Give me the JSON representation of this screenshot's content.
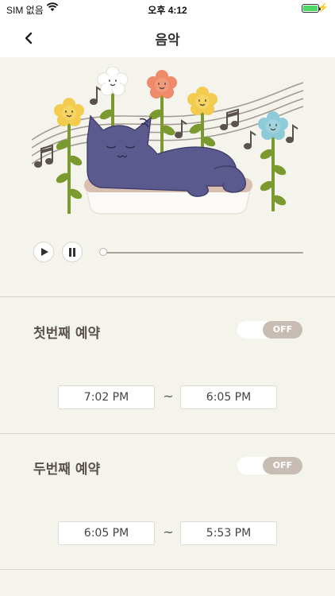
{
  "status_bar": {
    "carrier": "SIM 없음",
    "time": "오후 4:12"
  },
  "nav": {
    "title": "음악"
  },
  "player": {
    "progress": 0
  },
  "reservations": [
    {
      "title": "첫번째 예약",
      "toggle_label": "OFF",
      "start_time": "7:02 PM",
      "separator": "~",
      "end_time": "6:05 PM"
    },
    {
      "title": "두번째 예약",
      "toggle_label": "OFF",
      "start_time": "6:05 PM",
      "separator": "~",
      "end_time": "5:53 PM"
    }
  ],
  "colors": {
    "background": "#f4f3ec",
    "toggle_off": "#c8bdb4",
    "cat": "#5b5a8e",
    "stem": "#7a9a2f"
  }
}
